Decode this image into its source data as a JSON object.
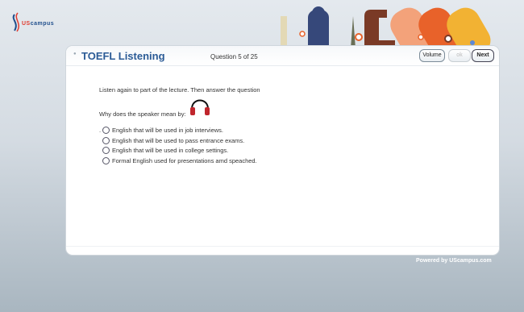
{
  "brand": {
    "prefix": "US",
    "name": "campus"
  },
  "header": {
    "title": "TOEFL Listening",
    "question_counter": "Question 5 of 25",
    "volume_label": "Volume",
    "ok_label": "ok",
    "next_label": "Next"
  },
  "content": {
    "instruction": "Listen again to part of the lecture. Then answer the question",
    "question": "Why does the speaker mean by:",
    "lead_mark": ".",
    "options": [
      "English that will be used in job interviews.",
      "English that will be used to pass entrance exams.",
      "English that will be used in college settings.",
      "Formal English used for presentations amd speached."
    ]
  },
  "footer": {
    "powered_by": "Powered by UScampus.com"
  },
  "colors": {
    "title": "#2b5b96",
    "accent_orange": "#e8622a",
    "accent_yellow": "#f2b233"
  },
  "icons": [
    "uscampus-logo",
    "headphones-icon",
    "radio-button"
  ]
}
